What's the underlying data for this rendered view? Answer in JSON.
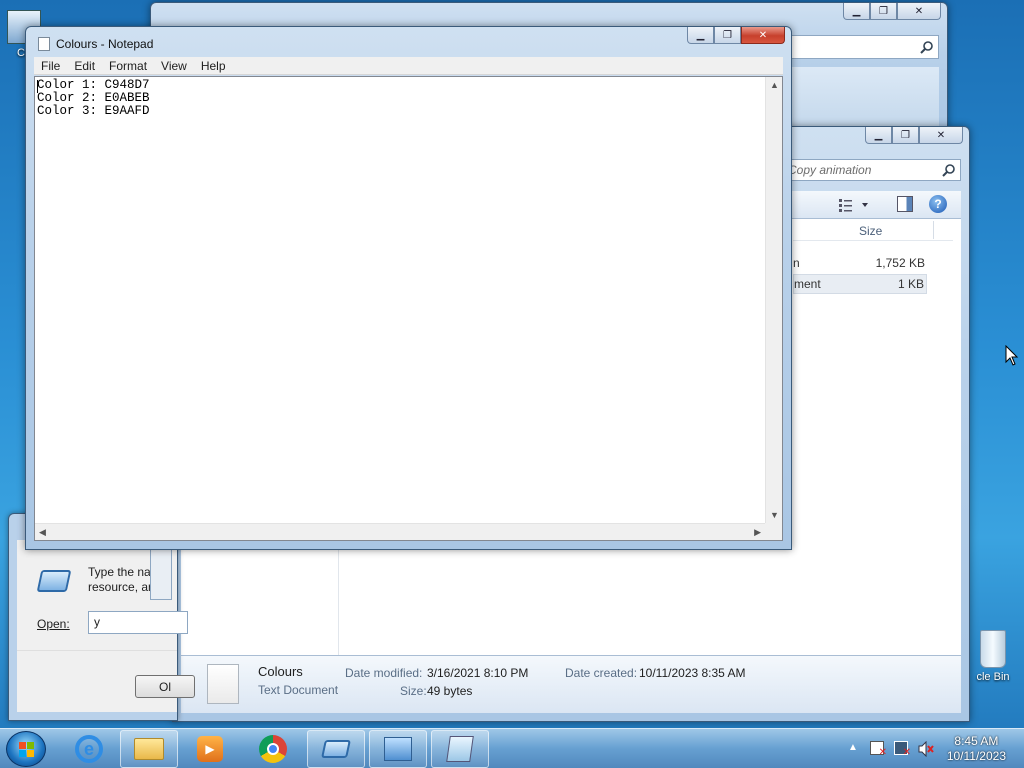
{
  "desktop": {
    "computer_icon_label": "Co",
    "recycle_bin_label": "cle Bin"
  },
  "explorer_back": {
    "caption_buttons": {
      "min": "▁",
      "max": "❐",
      "close": "✕"
    }
  },
  "explorer_front": {
    "search_placeholder": "Copy animation",
    "column_size": "Size",
    "files": [
      {
        "name_fragment": "n",
        "size": "1,752 KB"
      },
      {
        "name_fragment": "ment",
        "size": "1 KB"
      }
    ],
    "details": {
      "name": "Colours",
      "type": "Text Document",
      "date_modified_label": "Date modified:",
      "date_modified": "3/16/2021 8:10 PM",
      "size_label": "Size:",
      "size": "49 bytes",
      "date_created_label": "Date created:",
      "date_created": "10/11/2023 8:35 AM"
    }
  },
  "run_dialog": {
    "description_line1": "Type the nam",
    "description_line2": "resource, and",
    "open_label": "Open:",
    "open_value": "y",
    "ok_label": "Ol"
  },
  "notepad": {
    "title": "Colours - Notepad",
    "menu": [
      "File",
      "Edit",
      "Format",
      "View",
      "Help"
    ],
    "lines": [
      "Color 1: C948D7",
      "Color 2: E0ABEB",
      "Color 3: E9AAFD"
    ]
  },
  "taskbar": {
    "time": "8:45 AM",
    "date": "10/11/2023"
  },
  "colors": {
    "desktop_blue": "#1b6fb5",
    "close_red": "#c7402d"
  }
}
